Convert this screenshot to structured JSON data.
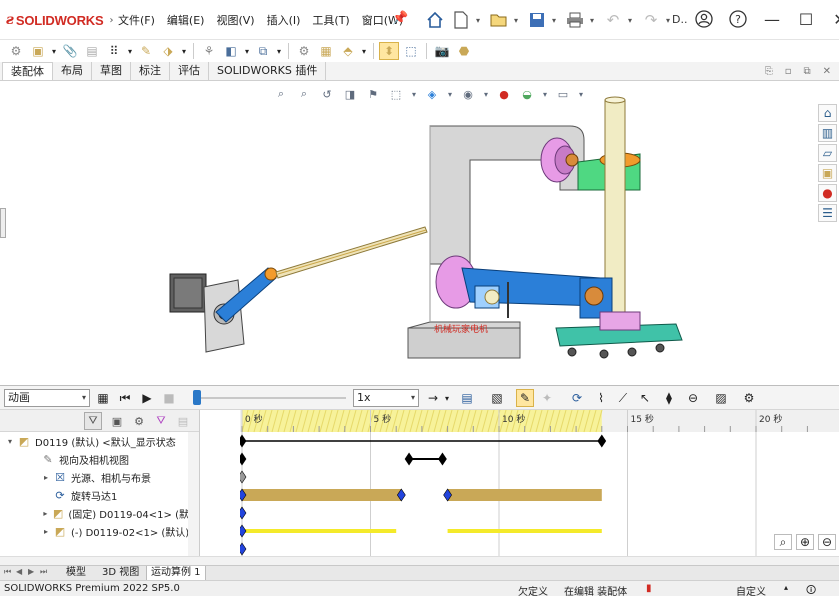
{
  "app": {
    "logo_prefix": "3DS",
    "logo_name": "SOLIDWORKS"
  },
  "menu": [
    "文件(F)",
    "编辑(E)",
    "视图(V)",
    "插入(I)",
    "工具(T)",
    "窗口(W)"
  ],
  "search_truncated": "D..",
  "command_tabs": [
    "装配体",
    "布局",
    "草图",
    "标注",
    "评估",
    "SOLIDWORKS 插件"
  ],
  "active_command_tab": "装配体",
  "motion": {
    "study_type": "动画",
    "playback_speed": "1x",
    "time_labels": [
      "0 秒",
      "5 秒",
      "10 秒",
      "15 秒",
      "20 秒"
    ],
    "tree": [
      {
        "label": "D0119 (默认) <默认_显示状态",
        "level": 0,
        "toggle": "▾",
        "icon": "assembly-icon"
      },
      {
        "label": "视向及相机视图",
        "level": 1,
        "toggle": "",
        "icon": "camera-icon"
      },
      {
        "label": "光源、相机与布景",
        "level": 1,
        "toggle": "▸",
        "icon": "lights-icon"
      },
      {
        "label": "旋转马达1",
        "level": 1,
        "toggle": "",
        "icon": "motor-icon"
      },
      {
        "label": "(固定) D0119-04<1> (默认",
        "level": 1,
        "toggle": "▸",
        "icon": "part-icon"
      },
      {
        "label": "(-) D0119-02<1> (默认)",
        "level": 1,
        "toggle": "▸",
        "icon": "part-icon"
      }
    ],
    "timeline": {
      "max_time_s": 10,
      "motor_bars": [
        [
          0,
          6.2
        ],
        [
          8.0,
          14.0
        ]
      ],
      "part_bars": [
        [
          0,
          6.0
        ],
        [
          8.0,
          14.0
        ]
      ],
      "key_time": 14.0,
      "view_lock_range": [
        6.5,
        7.8
      ]
    }
  },
  "model_label": "机械玩家电机",
  "bottom_tabs": [
    "模型",
    "3D 视图",
    "运动算例 1"
  ],
  "active_bottom_tab": "运动算例 1",
  "status": {
    "product": "SOLIDWORKS Premium 2022 SP5.0",
    "constraint": "欠定义",
    "editing": "在编辑 装配体",
    "units": "自定义"
  },
  "colors": {
    "accent_blue": "#2a78c7",
    "brand_red": "#d12b23",
    "timeline_highlight": "#f7f29a",
    "motor_bar": "#c9a857",
    "part_bar": "#f4ea2a"
  }
}
